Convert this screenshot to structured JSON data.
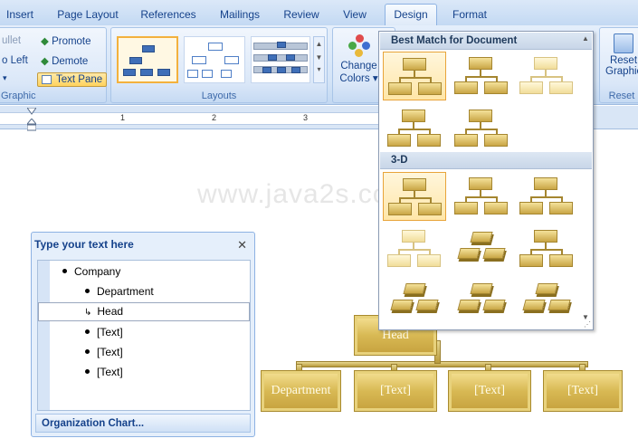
{
  "tabs": [
    {
      "label": "Insert"
    },
    {
      "label": "Page Layout"
    },
    {
      "label": "References"
    },
    {
      "label": "Mailings"
    },
    {
      "label": "Review"
    },
    {
      "label": "View"
    },
    {
      "label": "Design",
      "active": true
    },
    {
      "label": "Format"
    }
  ],
  "ribbon": {
    "create_graphic": {
      "label": "Graphic",
      "bullet": "ullet",
      "right_to_left": "o Left",
      "promote": "Promote",
      "demote": "Demote",
      "text_pane": "Text Pane"
    },
    "layouts": {
      "label": "Layouts"
    },
    "smartart_styles": {
      "change_colors_line1": "Change",
      "change_colors_line2": "Colors"
    },
    "reset": {
      "label": "Reset",
      "reset_line1": "Reset",
      "reset_line2": "Graphic"
    }
  },
  "ruler": {
    "marks": [
      "1",
      "2",
      "3"
    ]
  },
  "watermark": "www.java2s.com",
  "text_pane": {
    "title": "Type your text here",
    "close_icon": "close-icon",
    "items": [
      {
        "text": "Company",
        "level": 1
      },
      {
        "text": "Department",
        "level": 2
      },
      {
        "text": "Head",
        "level": 2,
        "assistant": true,
        "selected": true
      },
      {
        "text": "[Text]",
        "level": 2
      },
      {
        "text": "[Text]",
        "level": 2
      },
      {
        "text": "[Text]",
        "level": 2
      }
    ],
    "footer_link": "Organization Chart..."
  },
  "org_chart": {
    "head": "Head",
    "children": [
      "Department",
      "[Text]",
      "[Text]",
      "[Text]"
    ],
    "colors": {
      "fill": "#d8b954",
      "border": "#e8d27c"
    }
  },
  "style_gallery": {
    "section_best_match": "Best Match for Document",
    "section_3d": "3-D",
    "selected_best_match_index": 0,
    "selected_3d_index": 0,
    "accent": "#e8a43a"
  }
}
